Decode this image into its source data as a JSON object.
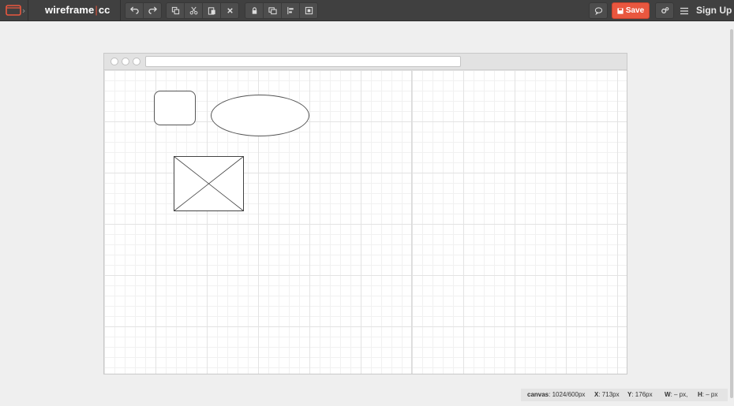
{
  "app": {
    "logo_left": "wireframe",
    "logo_sep": "|",
    "logo_right": "cc",
    "icons": {
      "app": "browser-window-icon",
      "undo": "undo-icon",
      "redo": "redo-icon",
      "copy": "copy-icon",
      "cut": "scissors-icon",
      "paste": "paste-icon",
      "delete": "close-icon",
      "lock": "lock-icon",
      "arrange": "bring-to-front-icon",
      "align": "align-icon",
      "fit": "fit-icon",
      "comment": "speech-bubble-icon",
      "save": "save-icon",
      "settings": "gears-icon",
      "menu": "hamburger-menu-icon"
    }
  },
  "toolbar": {
    "save_label": "Save",
    "signup_label": "Sign Up"
  },
  "colors": {
    "accent": "#e9573f",
    "toolbar_bg": "#404040",
    "canvas_bg": "#efefef"
  },
  "status": {
    "canvas_label": "canvas",
    "canvas_value": ": 1024/600px",
    "x_label": "X",
    "x_value": ": 713px",
    "y_label": "Y",
    "y_value": ": 176px",
    "w_label": "W",
    "w_value": ": – px,",
    "h_label": "H",
    "h_value": ": – px"
  }
}
